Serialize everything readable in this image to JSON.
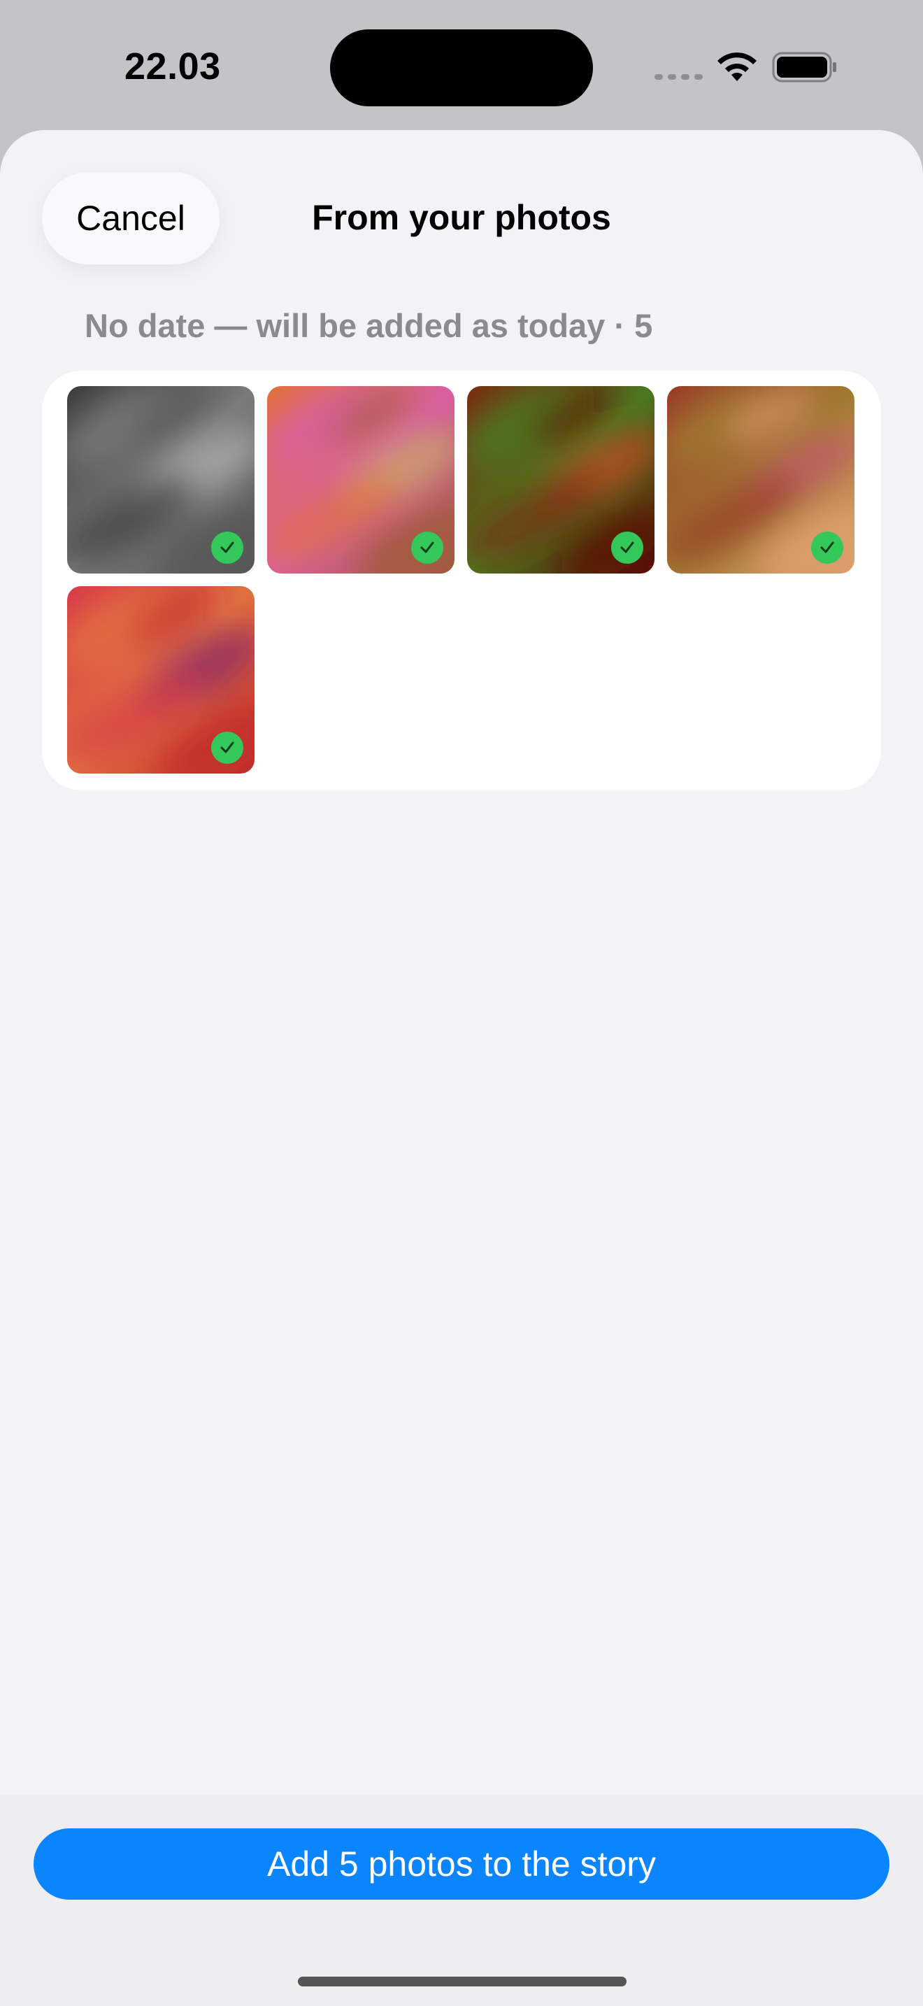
{
  "status_bar": {
    "time": "22.03",
    "icons": [
      "cellular-signal-icon",
      "wifi-icon",
      "battery-icon"
    ]
  },
  "sheet": {
    "cancel_label": "Cancel",
    "title": "From your photos",
    "section_header": "No date — will be added as today · 5",
    "photos": [
      {
        "name": "photo-1",
        "selected": true,
        "colors": [
          "#3a3a3a",
          "#7a7a7a",
          "#b0b0b0",
          "#555555"
        ]
      },
      {
        "name": "photo-2",
        "selected": true,
        "colors": [
          "#e0703a",
          "#d85fa0",
          "#c9a96a",
          "#a05a3a"
        ]
      },
      {
        "name": "photo-3",
        "selected": true,
        "colors": [
          "#7a2a14",
          "#4a7a20",
          "#c04a20",
          "#5a0a08"
        ]
      },
      {
        "name": "photo-4",
        "selected": true,
        "colors": [
          "#9a3a2a",
          "#a07a30",
          "#c05a6a",
          "#e0a070"
        ]
      },
      {
        "name": "photo-5",
        "selected": true,
        "colors": [
          "#d83a4a",
          "#e07040",
          "#8a2a6a",
          "#c02a2a"
        ]
      }
    ],
    "check_color": "#34c759"
  },
  "footer": {
    "add_button_label": "Add 5 photos to the story",
    "accent": "#0a84ff"
  }
}
